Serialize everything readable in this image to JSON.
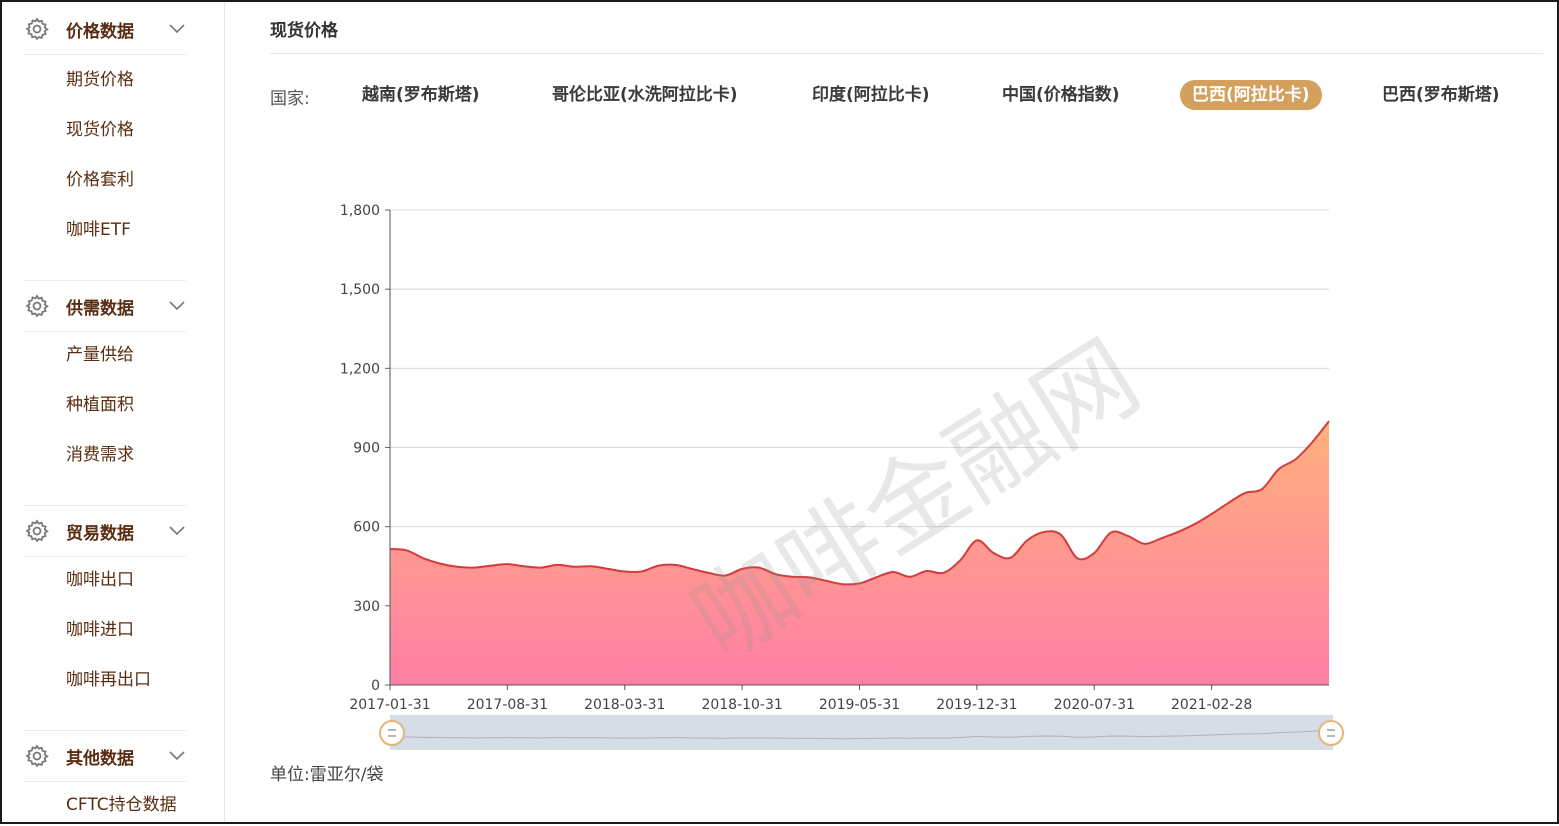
{
  "sidebar": {
    "groups": [
      {
        "title": "价格数据",
        "items": [
          "期货价格",
          "现货价格",
          "价格套利",
          "咖啡ETF"
        ]
      },
      {
        "title": "供需数据",
        "items": [
          "产量供给",
          "种植面积",
          "消费需求"
        ]
      },
      {
        "title": "贸易数据",
        "items": [
          "咖啡出口",
          "咖啡进口",
          "咖啡再出口"
        ]
      },
      {
        "title": "其他数据",
        "items": [
          "CFTC持仓数据"
        ]
      }
    ]
  },
  "page": {
    "title": "现货价格",
    "country_label": "国家:",
    "unit_label": "单位:雷亚尔/袋",
    "watermark": "咖啡金融网"
  },
  "countries": [
    {
      "label": "越南(罗布斯塔)",
      "active": false
    },
    {
      "label": "哥伦比亚(水洗阿拉比卡)",
      "active": false
    },
    {
      "label": "印度(阿拉比卡)",
      "active": false
    },
    {
      "label": "中国(价格指数)",
      "active": false
    },
    {
      "label": "巴西(阿拉比卡)",
      "active": true
    },
    {
      "label": "巴西(罗布斯塔)",
      "active": false
    }
  ],
  "colors": {
    "accent": "#d4a05d",
    "text_brown": "#5a2d12",
    "line": "#d23c3c",
    "fill_top": "#ffb07c",
    "fill_bottom": "#ff7fa5"
  },
  "chart_data": {
    "type": "area",
    "ylim": [
      0,
      1800
    ],
    "yticks": [
      "0",
      "300",
      "600",
      "900",
      "1,200",
      "1,500",
      "1,800"
    ],
    "xticks": [
      "2017-01-31",
      "2017-08-31",
      "2018-03-31",
      "2018-10-31",
      "2019-05-31",
      "2019-12-31",
      "2020-07-31",
      "2021-02-28"
    ],
    "grid": true,
    "series": [
      {
        "x": [
          "2017-01",
          "2017-02",
          "2017-03",
          "2017-04",
          "2017-05",
          "2017-06",
          "2017-07",
          "2017-08",
          "2017-09",
          "2017-10",
          "2017-11",
          "2017-12",
          "2018-01",
          "2018-02",
          "2018-03",
          "2018-04",
          "2018-05",
          "2018-06",
          "2018-07",
          "2018-08",
          "2018-09",
          "2018-10",
          "2018-11",
          "2018-12",
          "2019-01",
          "2019-02",
          "2019-03",
          "2019-04",
          "2019-05",
          "2019-06",
          "2019-07",
          "2019-08",
          "2019-09",
          "2019-10",
          "2019-11",
          "2019-12",
          "2020-01",
          "2020-02",
          "2020-03",
          "2020-04",
          "2020-05",
          "2020-06",
          "2020-07",
          "2020-08",
          "2020-09",
          "2020-10",
          "2020-11",
          "2020-12",
          "2021-01",
          "2021-02",
          "2021-03",
          "2021-04",
          "2021-05",
          "2021-06",
          "2021-07",
          "2021-08",
          "2021-09"
        ],
        "values": [
          515,
          510,
          480,
          460,
          448,
          445,
          452,
          458,
          450,
          445,
          455,
          448,
          450,
          440,
          430,
          430,
          452,
          455,
          440,
          425,
          415,
          440,
          445,
          420,
          410,
          408,
          395,
          382,
          385,
          408,
          428,
          410,
          432,
          425,
          472,
          548,
          500,
          482,
          548,
          580,
          570,
          480,
          500,
          578,
          565,
          535,
          556,
          580,
          610,
          648,
          690,
          728,
          742,
          818,
          855,
          920,
          1000
        ]
      }
    ]
  }
}
